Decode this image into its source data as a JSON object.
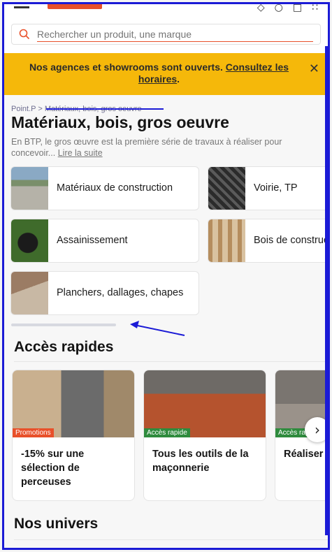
{
  "search": {
    "placeholder": "Rechercher un produit, une marque"
  },
  "notice": {
    "text": "Nos agences et showrooms sont ouverts.",
    "link": "Consultez les horaires",
    "end": "."
  },
  "breadcrumb": {
    "home": "Point.P",
    "sep": ">",
    "current": "Matériaux, bois, gros oeuvre"
  },
  "page": {
    "title": "Matériaux, bois, gros oeuvre",
    "description": "En BTP, le gros œuvre est la première série de travaux à réaliser pour concevoir...",
    "read_more": "Lire la suite"
  },
  "categories": [
    {
      "label": "Matériaux de construction"
    },
    {
      "label": "Voirie, TP"
    },
    {
      "label": "Assainissement"
    },
    {
      "label": "Bois de construction, panneaux"
    },
    {
      "label": "Planchers, dallages, chapes"
    }
  ],
  "quick_access": {
    "title": "Accès rapides",
    "cards": [
      {
        "badge": "Promotions",
        "text": "-15% sur une sélection de perceuses",
        "badge_color": "#e8502a"
      },
      {
        "badge": "Accès rapide",
        "text": "Tous les outils de la maçonnerie",
        "badge_color": "#2e8b3d"
      },
      {
        "badge": "Accès rapide",
        "text": "Réaliser un dallage",
        "badge_color": "#2e8b3d"
      }
    ]
  },
  "univers": {
    "title": "Nos univers"
  },
  "colors": {
    "accent": "#e8502a",
    "notice": "#f5b80a",
    "annotation": "#1b1bd6"
  }
}
